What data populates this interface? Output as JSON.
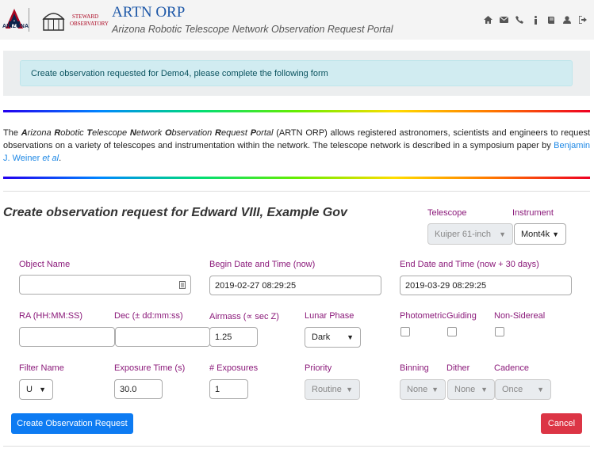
{
  "header": {
    "logo_text": "ARIZONA",
    "steward_line1": "STEWARD",
    "steward_line2": "OBSERVATORY",
    "title": "ARTN ORP",
    "subtitle": "Arizona Robotic Telescope Network Observation Request Portal",
    "icons": [
      "home-icon",
      "envelope-icon",
      "phone-icon",
      "info-icon",
      "book-icon",
      "user-icon",
      "sign-out-icon"
    ]
  },
  "alert": {
    "text": "Create observation requested for Demo4, please complete the following form"
  },
  "intro": {
    "the": "The",
    "name_parts": [
      {
        "b": "A",
        "r": "rizona "
      },
      {
        "b": "R",
        "r": "obotic "
      },
      {
        "b": "T",
        "r": "elescope "
      },
      {
        "b": "N",
        "r": "etwork "
      },
      {
        "b": "O",
        "r": "bservation "
      },
      {
        "b": "R",
        "r": "equest "
      },
      {
        "b": "P",
        "r": "ortal"
      }
    ],
    "body": " (ARTN ORP) allows registered astronomers, scientists and engineers to request observations on a variety of telescopes and instrumentation within the network. The telescope network is described in a symposium paper by ",
    "link": "Benjamin J. Weiner ",
    "link_em": "et al",
    "end": "."
  },
  "form": {
    "title": "Create observation request for Edward VIII, Example Gov",
    "telescope": {
      "label": "Telescope",
      "value": "Kuiper 61-inch"
    },
    "instrument": {
      "label": "Instrument",
      "value": "Mont4k"
    },
    "object_name": {
      "label": "Object Name",
      "value": ""
    },
    "begin": {
      "label": "Begin Date and Time (now)",
      "value": "2019-02-27 08:29:25"
    },
    "end": {
      "label": "End Date and Time (now + 30 days)",
      "value": "2019-03-29 08:29:25"
    },
    "ra": {
      "label": "RA (HH:MM:SS)",
      "value": ""
    },
    "dec": {
      "label": "Dec (± dd:mm:ss)",
      "value": ""
    },
    "airmass": {
      "label": "Airmass (∝ sec Z)",
      "value": "1.25"
    },
    "lunar": {
      "label": "Lunar Phase",
      "value": "Dark"
    },
    "photometric": {
      "label": "Photometric"
    },
    "guiding": {
      "label": "Guiding"
    },
    "nonsidereal": {
      "label": "Non-Sidereal"
    },
    "filter": {
      "label": "Filter Name",
      "value": "U"
    },
    "exposure": {
      "label": "Exposure Time (s)",
      "value": "30.0"
    },
    "nexp": {
      "label": "# Exposures",
      "value": "1"
    },
    "priority": {
      "label": "Priority",
      "value": "Routine"
    },
    "binning": {
      "label": "Binning",
      "value": "None"
    },
    "dither": {
      "label": "Dither",
      "value": "None"
    },
    "cadence": {
      "label": "Cadence",
      "value": "Once"
    },
    "submit": "Create Observation Request",
    "cancel": "Cancel"
  },
  "colors": {
    "accent": "#0d7bf2",
    "danger": "#dc3545",
    "label": "#8b1a7a",
    "title": "#1e58a8"
  }
}
